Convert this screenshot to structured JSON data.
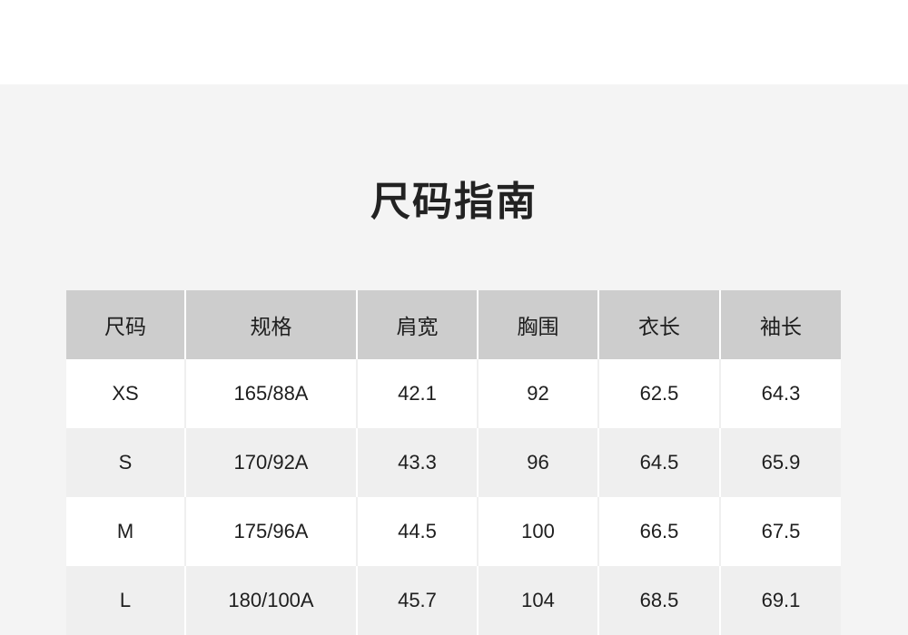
{
  "title": "尺码指南",
  "table": {
    "headers": [
      "尺码",
      "规格",
      "肩宽",
      "胸围",
      "衣长",
      "袖长"
    ],
    "rows": [
      [
        "XS",
        "165/88A",
        "42.1",
        "92",
        "62.5",
        "64.3"
      ],
      [
        "S",
        "170/92A",
        "43.3",
        "96",
        "64.5",
        "65.9"
      ],
      [
        "M",
        "175/96A",
        "44.5",
        "100",
        "66.5",
        "67.5"
      ],
      [
        "L",
        "180/100A",
        "45.7",
        "104",
        "68.5",
        "69.1"
      ]
    ]
  }
}
